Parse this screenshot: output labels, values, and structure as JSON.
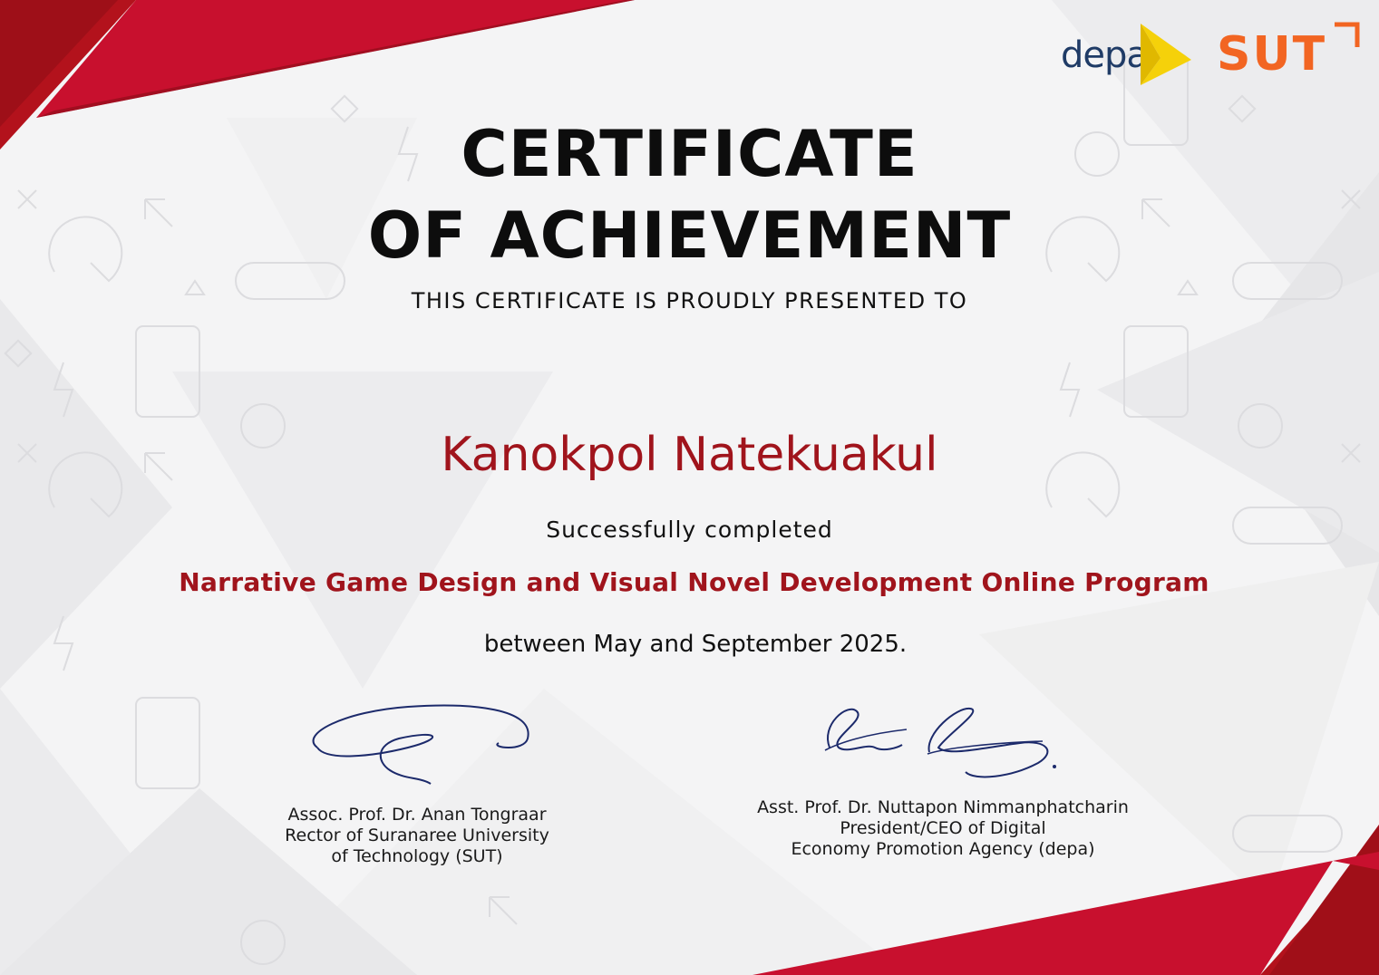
{
  "logos": {
    "depa": "depa",
    "sut": "SUT"
  },
  "certificate": {
    "title_line1": "CERTIFICATE",
    "title_line2": "OF ACHIEVEMENT",
    "presented_to": "THIS CERTIFICATE IS PROUDLY PRESENTED TO",
    "recipient": "Kanokpol Natekuakul",
    "completed": "Successfully completed",
    "program": "Narrative Game Design and Visual Novel Development Online Program",
    "period": "between May and September 2025."
  },
  "signatories": {
    "left": {
      "name": "Assoc. Prof. Dr. Anan Tongraar",
      "title_line1": "Rector of Suranaree University",
      "title_line2": "of Technology (SUT)"
    },
    "right": {
      "name": "Asst. Prof. Dr. Nuttapon Nimmanphatcharin",
      "title_line1": "President/CEO of Digital",
      "title_line2": "Economy Promotion Agency (depa)"
    }
  },
  "colors": {
    "accent_red": "#a0141c",
    "border_red": "#c8102e",
    "depa_navy": "#1f3b66",
    "depa_yellow": "#f5d10a",
    "sut_orange": "#f26522",
    "ink_blue": "#1c2a6b"
  }
}
